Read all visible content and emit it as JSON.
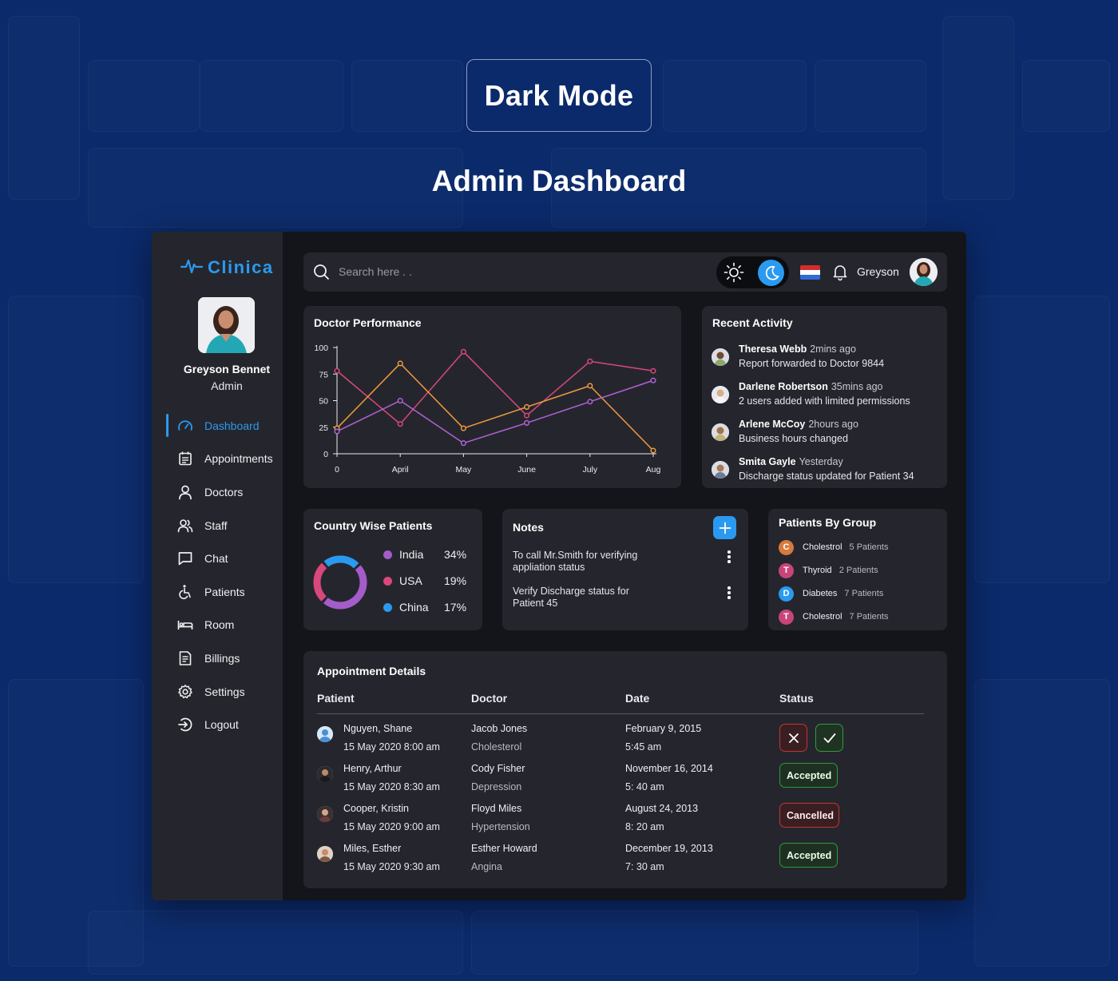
{
  "header": {
    "badge": "Dark Mode",
    "title": "Admin Dashboard"
  },
  "sidebar": {
    "logo": "Clinica",
    "profile": {
      "name": "Greyson Bennet",
      "role": "Admin"
    },
    "items": [
      {
        "label": "Dashboard",
        "icon": "dashboard-gauge-icon"
      },
      {
        "label": "Appointments",
        "icon": "calendar-icon"
      },
      {
        "label": "Doctors",
        "icon": "person-icon"
      },
      {
        "label": "Staff",
        "icon": "people-icon"
      },
      {
        "label": "Chat",
        "icon": "chat-icon"
      },
      {
        "label": "Patients",
        "icon": "wheelchair-icon"
      },
      {
        "label": "Room",
        "icon": "bed-icon"
      },
      {
        "label": "Billings",
        "icon": "invoice-icon"
      },
      {
        "label": "Settings",
        "icon": "gear-icon"
      },
      {
        "label": "Logout",
        "icon": "logout-icon"
      }
    ],
    "active_index": 0
  },
  "topbar": {
    "search_placeholder": "Search here . .",
    "user_name": "Greyson",
    "theme": "dark"
  },
  "performance": {
    "title": "Doctor Performance"
  },
  "chart_data": {
    "type": "line",
    "title": "Doctor Performance",
    "categories": [
      "0",
      "April",
      "May",
      "June",
      "July",
      "Aug"
    ],
    "x_positions": [
      0,
      1,
      2,
      3,
      4,
      5
    ],
    "ylim": [
      0,
      100
    ],
    "yticks": [
      0,
      25,
      50,
      75,
      100
    ],
    "series": [
      {
        "color": "#d8487a",
        "values": [
          78,
          28,
          96,
          36,
          87,
          78
        ]
      },
      {
        "color": "#f09a3e",
        "values": [
          24,
          85,
          24,
          44,
          64,
          3
        ]
      },
      {
        "color": "#b062d6",
        "values": [
          21,
          50,
          10,
          29,
          49,
          69
        ]
      }
    ]
  },
  "activity": {
    "title": "Recent Activity",
    "items": [
      {
        "name": "Theresa Webb",
        "time": "2mins ago",
        "desc": "Report forwarded to Doctor 9844"
      },
      {
        "name": "Darlene Robertson",
        "time": "35mins ago",
        "desc": "2 users added with limited permissions"
      },
      {
        "name": "Arlene McCoy",
        "time": "2hours ago",
        "desc": "Business hours changed"
      },
      {
        "name": "Smita Gayle",
        "time": "Yesterday",
        "desc": "Discharge status updated for Patient 34"
      }
    ]
  },
  "country": {
    "title": "Country Wise Patients",
    "rows": [
      {
        "country": "India",
        "pct": "34%",
        "value": 34,
        "color": "#a35cc9"
      },
      {
        "country": "USA",
        "pct": "19%",
        "value": 19,
        "color": "#d8487a"
      },
      {
        "country": "China",
        "pct": "17%",
        "value": 17,
        "color": "#2a9af0"
      }
    ]
  },
  "notes": {
    "title": "Notes",
    "items": [
      {
        "text": "To call Mr.Smith for verifying appliation status"
      },
      {
        "text": "Verify Discharge status for Patient 45"
      }
    ]
  },
  "groups": {
    "title": "Patients By Group",
    "rows": [
      {
        "letter": "C",
        "name": "Cholestrol",
        "count": "5 Patients",
        "color": "#d67a3d"
      },
      {
        "letter": "T",
        "name": "Thyroid",
        "count": "2 Patients",
        "color": "#c8457a"
      },
      {
        "letter": "D",
        "name": "Diabetes",
        "count": "7 Patients",
        "color": "#2a9af0"
      },
      {
        "letter": "T",
        "name": "Cholestrol",
        "count": "7 Patients",
        "color": "#c8457a"
      }
    ]
  },
  "appointments": {
    "title": "Appointment Details",
    "columns": [
      "Patient",
      "Doctor",
      "Date",
      "Status"
    ],
    "rows": [
      {
        "patient": "Nguyen, Shane",
        "slot": "15 May 2020 8:00 am",
        "doctor": "Jacob Jones",
        "condition": "Cholesterol",
        "date": "February 9, 2015",
        "time": "5:45 am",
        "status": "pending"
      },
      {
        "patient": "Henry, Arthur",
        "slot": "15 May 2020 8:30 am",
        "doctor": "Cody Fisher",
        "condition": "Depression",
        "date": "November 16, 2014",
        "time": "5: 40 am",
        "status": "Accepted"
      },
      {
        "patient": "Cooper, Kristin",
        "slot": "15 May 2020 9:00 am",
        "doctor": "Floyd Miles",
        "condition": "Hypertension",
        "date": "August 24, 2013",
        "time": "8: 20 am",
        "status": "Cancelled"
      },
      {
        "patient": "Miles, Esther",
        "slot": "15 May 2020 9:30 am",
        "doctor": "Esther Howard",
        "condition": "Angina",
        "date": "December 19, 2013",
        "time": "7: 30 am",
        "status": "Accepted"
      }
    ]
  }
}
